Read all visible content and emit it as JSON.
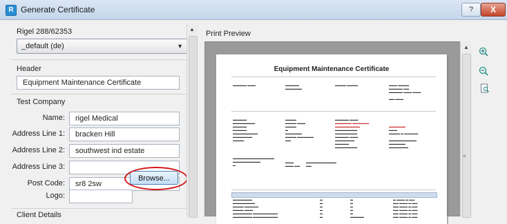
{
  "window": {
    "title": "Generate Certificate",
    "help_label": "?",
    "close_label": "X"
  },
  "left": {
    "instrument_label": "Rigel 288/62353",
    "template_select": {
      "value": "_default (de)"
    },
    "header_section": {
      "label": "Header",
      "value": "Equipment Maintenance Certificate"
    },
    "test_company": {
      "label": "Test Company",
      "fields": [
        {
          "label": "Name:",
          "value": "rigel Medical"
        },
        {
          "label": "Address Line 1:",
          "value": "bracken Hill"
        },
        {
          "label": "Address Line 2:",
          "value": "southwest ind estate"
        },
        {
          "label": "Address Line 3:",
          "value": ""
        },
        {
          "label": "Post Code:",
          "value": "sr8 2sw"
        }
      ],
      "logo_label": "Logo:",
      "browse_label": "Browse..."
    },
    "client_details_label": "Client Details"
  },
  "preview": {
    "label": "Print Preview",
    "page_title": "Equipment Maintenance Certificate",
    "tools": [
      "zoom-in-icon",
      "zoom-out-icon",
      "page-view-icon"
    ]
  }
}
